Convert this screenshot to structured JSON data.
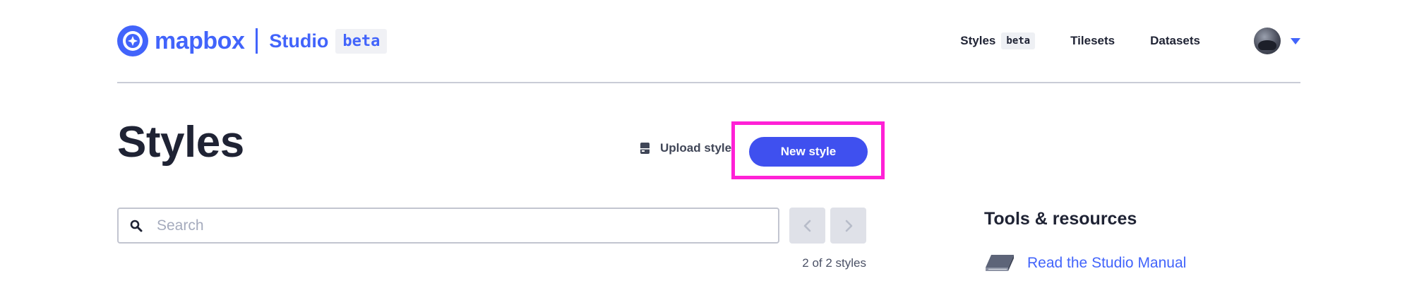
{
  "brand": {
    "wordmark": "mapbox",
    "product": "Studio",
    "badge": "beta"
  },
  "nav": {
    "items": [
      {
        "label": "Styles",
        "badge": "beta"
      },
      {
        "label": "Tilesets"
      },
      {
        "label": "Datasets"
      }
    ]
  },
  "main": {
    "title": "Styles",
    "upload_label": "Upload style",
    "new_style_label": "New style",
    "search_placeholder": "Search",
    "count_text": "2 of 2 styles"
  },
  "sidebar": {
    "title": "Tools & resources",
    "links": [
      {
        "label": "Read the Studio Manual",
        "icon": "book-icon"
      }
    ]
  },
  "colors": {
    "brand_blue": "#4264fb",
    "button_blue": "#3f50ef",
    "highlight": "#ff21d6"
  }
}
